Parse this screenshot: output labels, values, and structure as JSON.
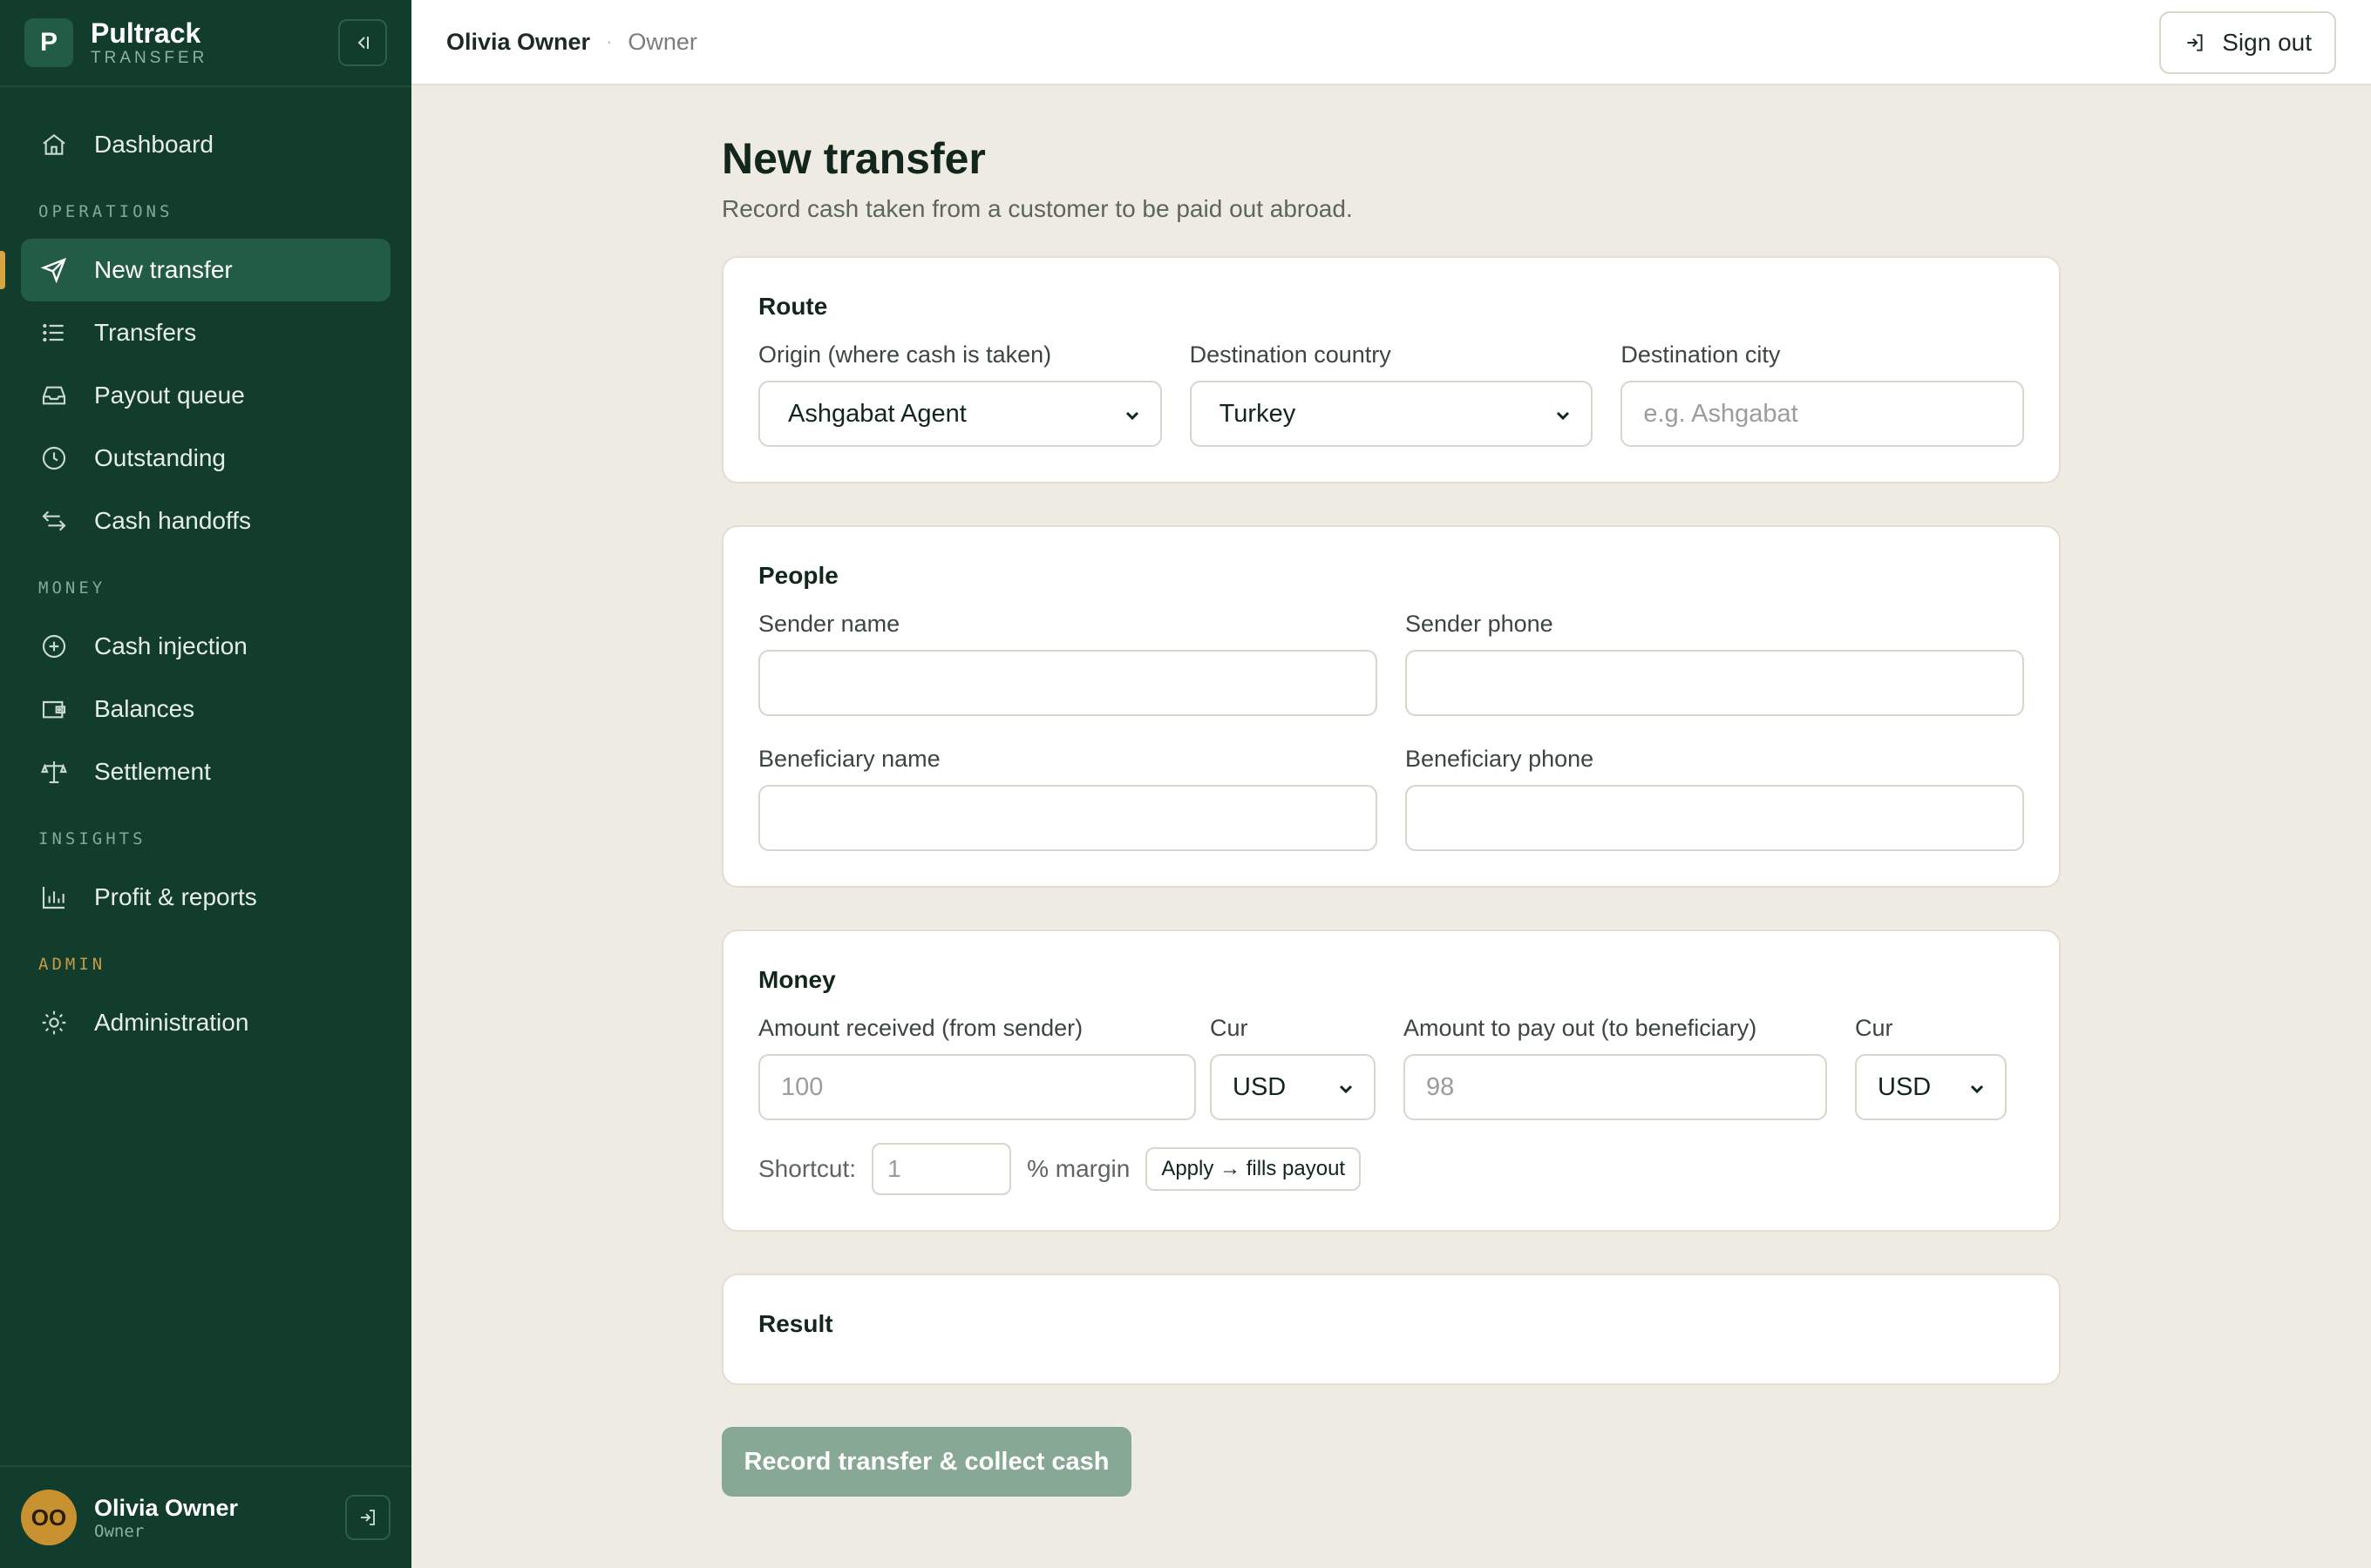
{
  "brand": {
    "logo_letter": "P",
    "name": "Pultrack",
    "sub": "TRANSFER"
  },
  "sidebar": {
    "dashboard": "Dashboard",
    "sections": {
      "operations": "OPERATIONS",
      "money": "MONEY",
      "insights": "INSIGHTS",
      "admin": "ADMIN"
    },
    "items": {
      "new_transfer": "New transfer",
      "transfers": "Transfers",
      "payout_queue": "Payout queue",
      "outstanding": "Outstanding",
      "cash_handoffs": "Cash handoffs",
      "cash_injection": "Cash injection",
      "balances": "Balances",
      "settlement": "Settlement",
      "profit_reports": "Profit & reports",
      "administration": "Administration"
    },
    "active": "new_transfer",
    "user": {
      "initials": "OO",
      "name": "Olivia Owner",
      "role": "Owner"
    }
  },
  "topbar": {
    "user": "Olivia Owner",
    "separator": "·",
    "role": "Owner",
    "sign_out": "Sign out"
  },
  "page": {
    "title": "New transfer",
    "subtitle": "Record cash taken from a customer to be paid out abroad."
  },
  "route": {
    "title": "Route",
    "origin_label": "Origin (where cash is taken)",
    "origin_value": "Ashgabat Agent",
    "dest_country_label": "Destination country",
    "dest_country_value": "Turkey",
    "dest_city_label": "Destination city",
    "dest_city_placeholder": "e.g. Ashgabat"
  },
  "people": {
    "title": "People",
    "sender_name_label": "Sender name",
    "sender_phone_label": "Sender phone",
    "beneficiary_name_label": "Beneficiary name",
    "beneficiary_phone_label": "Beneficiary phone"
  },
  "money": {
    "title": "Money",
    "received_label": "Amount received (from sender)",
    "received_placeholder": "100",
    "cur_label": "Cur",
    "received_cur": "USD",
    "payout_label": "Amount to pay out (to beneficiary)",
    "payout_placeholder": "98",
    "payout_cur": "USD",
    "shortcut_label": "Shortcut:",
    "margin_placeholder": "1",
    "margin_suffix": "% margin",
    "apply_label": "Apply → fills payout"
  },
  "result": {
    "title": "Result"
  },
  "actions": {
    "record": "Record transfer & collect cash"
  },
  "colors": {
    "sidebar": "#123c2b",
    "active": "#235c44",
    "accent": "#d9a441",
    "button": "#86a894"
  }
}
